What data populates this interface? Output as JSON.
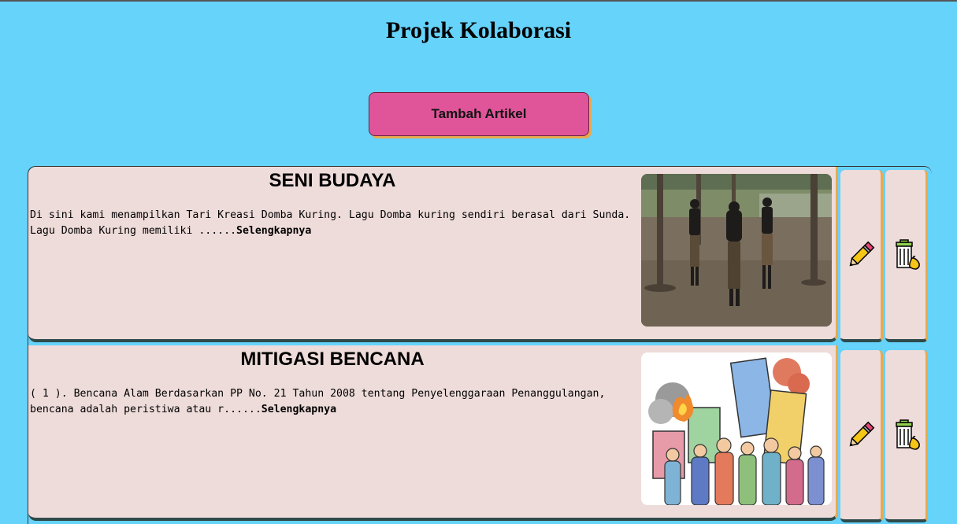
{
  "page": {
    "title": "Projek Kolaborasi"
  },
  "toolbar": {
    "add_label": "Tambah Artikel"
  },
  "articles": [
    {
      "title": "SENI BUDAYA",
      "summary": "Di sini kami menampilkan Tari Kreasi Domba Kuring. Lagu Domba kuring sendiri berasal dari Sunda. Lagu Domba Kuring memiliki ......",
      "read_more": "Selengkapnya",
      "image": "dance-photo",
      "edit_icon": "pencil-icon",
      "delete_icon": "trash-icon"
    },
    {
      "title": "MITIGASI BENCANA",
      "summary": "( 1 ). Bencana Alam Berdasarkan PP No. 21 Tahun 2008 tentang Penyelenggaraan Penanggulangan, bencana adalah peristiwa atau r......",
      "read_more": "Selengkapnya",
      "image": "disaster-illustration",
      "edit_icon": "pencil-icon",
      "delete_icon": "trash-icon"
    }
  ],
  "colors": {
    "background": "#66d3fb",
    "button": "#e05599",
    "card": "#eedcda",
    "accent": "#e8a94e",
    "card_shadow": "#2f4a4a"
  }
}
